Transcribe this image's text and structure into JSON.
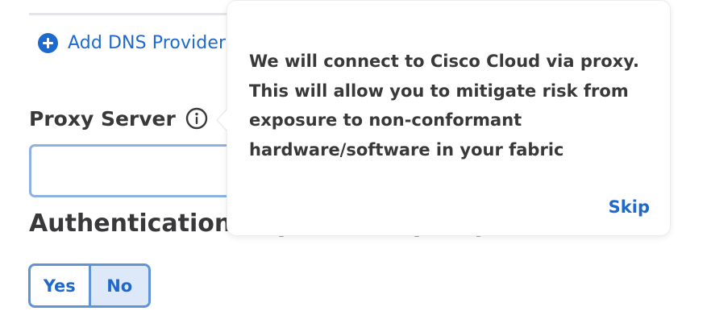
{
  "dns": {
    "add_provider_label": "Add DNS Provider",
    "add_icon": "plus-circle-icon"
  },
  "proxy": {
    "label": "Proxy Server",
    "info_icon": "info-icon",
    "input_value": "",
    "input_placeholder": ""
  },
  "auth": {
    "label": "Authentication required for proxy",
    "options": [
      {
        "label": "Yes",
        "selected": false
      },
      {
        "label": "No",
        "selected": true
      }
    ]
  },
  "popover": {
    "lines": [
      "We will connect to Cisco Cloud via proxy.",
      "This will allow you to mitigate risk from",
      "exposure to non-conformant",
      "hardware/software in your fabric"
    ],
    "skip_label": "Skip"
  },
  "colors": {
    "accent": "#1d69cc",
    "text": "#39393b",
    "input_border": "#8eb1e2",
    "toggle_selected_bg": "#dde9f8"
  }
}
